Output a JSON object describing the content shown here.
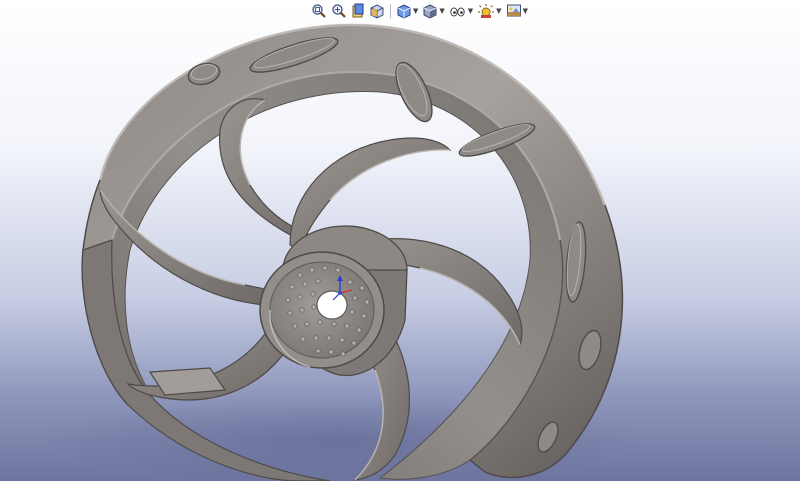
{
  "toolbar": {
    "buttons": [
      {
        "name": "zoom-to-fit",
        "icon": "zoom-fit-icon"
      },
      {
        "name": "zoom-to-area",
        "icon": "zoom-area-icon"
      },
      {
        "name": "previous-view",
        "icon": "previous-view-icon"
      },
      {
        "name": "section-view",
        "icon": "section-view-icon"
      },
      {
        "name": "view-orientation",
        "icon": "view-orientation-icon",
        "has_dropdown": true
      },
      {
        "name": "display-style",
        "icon": "display-style-icon",
        "has_dropdown": true
      },
      {
        "name": "hide-show-items",
        "icon": "hide-show-icon",
        "has_dropdown": true
      },
      {
        "name": "edit-appearance",
        "icon": "appearance-icon",
        "has_dropdown": true
      },
      {
        "name": "apply-scene",
        "icon": "scene-icon",
        "has_dropdown": true
      }
    ]
  },
  "colors": {
    "part_gray": "#8a8582",
    "part_highlight": "#c9c4c0",
    "part_shadow": "#4f4b49",
    "background_top": "#ffffff",
    "background_bottom": "#6d759f",
    "triad_x": "#d23030",
    "triad_y": "#2c3ed6"
  }
}
